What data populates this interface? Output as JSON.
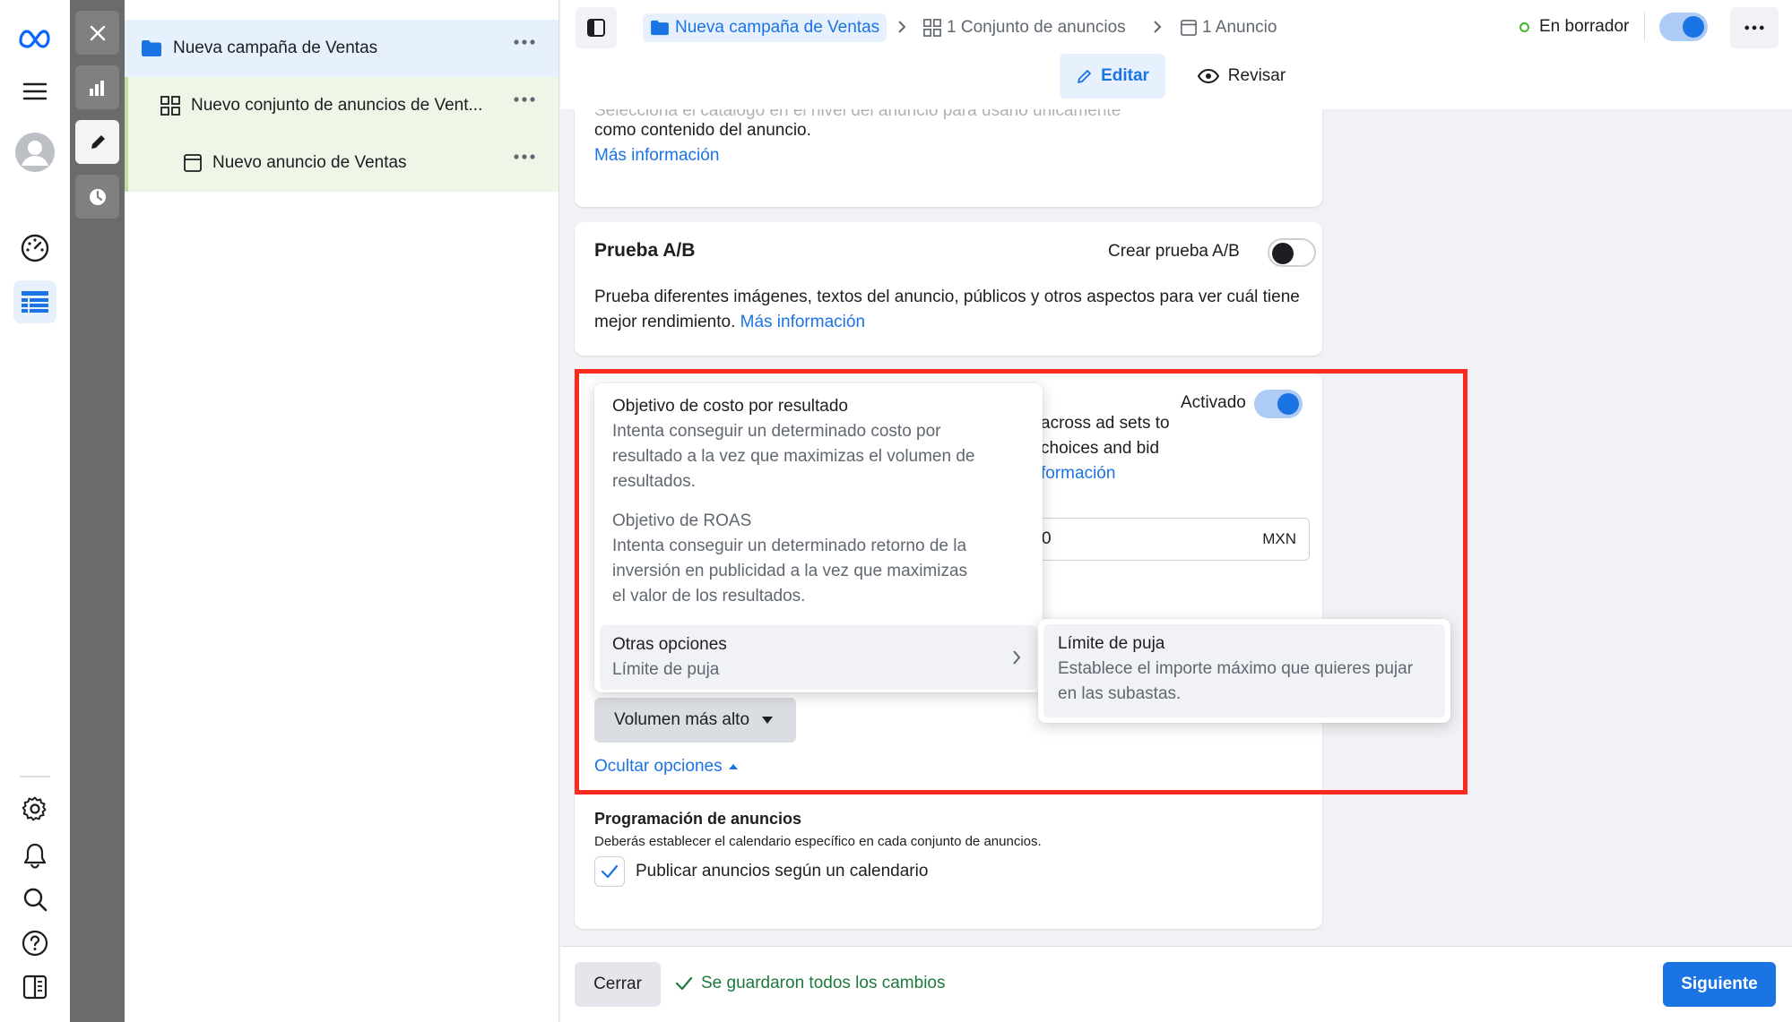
{
  "tree": {
    "campaign": "Nueva campaña de Ventas",
    "adset": "Nuevo conjunto de anuncios de Vent...",
    "ad": "Nuevo anuncio de Ventas"
  },
  "breadcrumb": {
    "campaign": "Nueva campaña de Ventas",
    "adsets": "1 Conjunto de anuncios",
    "ads": "1 Anuncio"
  },
  "status": {
    "label": "En borrador",
    "color": "#42b72a"
  },
  "modes": {
    "edit": "Editar",
    "review": "Revisar"
  },
  "catalog_card": {
    "partial_line": "Selecciona el catálogo en el nivel del anuncio para usarlo únicamente",
    "line2": "como contenido del anuncio.",
    "link": "Más información"
  },
  "ab_test": {
    "title": "Prueba A/B",
    "toggle_label": "Crear prueba A/B",
    "toggle_on": false,
    "description": "Prueba diferentes imágenes, textos del anuncio, públicos y otros aspectos para ver cuál tiene mejor rendimiento.",
    "link": "Más información"
  },
  "budget_card": {
    "toggle_label": "Activado",
    "toggle_on": true,
    "partial_lines": [
      "across ad sets to",
      "choices and bid",
      "formación"
    ],
    "input_suffix": "MXN",
    "input_value": "0"
  },
  "bid_menu": {
    "items": [
      {
        "title": "Objetivo de costo por resultado",
        "desc_lines": [
          "Intenta conseguir un determinado costo por",
          "resultado a la vez que maximizas el volumen de",
          "resultados."
        ]
      },
      {
        "title": "Objetivo de ROAS",
        "desc_lines": [
          "Intenta conseguir un determinado retorno de la",
          "inversión en publicidad a la vez que maximizas",
          "el valor de los resultados."
        ]
      },
      {
        "title": "Otras opciones",
        "desc_lines": [
          "Límite de puja"
        ]
      }
    ]
  },
  "submenu": {
    "title": "Límite de puja",
    "desc_lines": [
      "Establece el importe máximo que quieres pujar",
      "en las subastas."
    ]
  },
  "strategy_dropdown": "Volumen más alto",
  "hide_options": "Ocultar opciones",
  "schedule": {
    "title": "Programación de anuncios",
    "description": "Deberás establecer el calendario específico en cada conjunto de anuncios.",
    "checkbox_label": "Publicar anuncios según un calendario",
    "checked": true
  },
  "footer": {
    "close": "Cerrar",
    "saved": "Se guardaron todos los cambios",
    "next": "Siguiente"
  },
  "colors": {
    "accent": "#1b74e4",
    "highlight_box": "#fa2a1e",
    "saved_text": "#1c7a3a"
  }
}
